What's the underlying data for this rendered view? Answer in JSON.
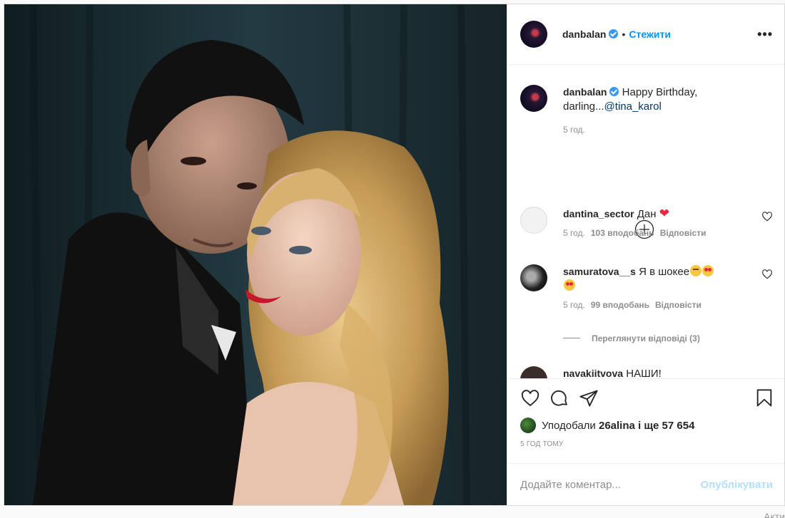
{
  "post": {
    "author": "danbalan",
    "follow_label": "Стежити",
    "dot": "•",
    "more_label": "•••",
    "caption_text": "Happy Birthday, darling...",
    "caption_mention": "@tina_karol",
    "caption_time": "5 год."
  },
  "comments": [
    {
      "user": "dantina_sector",
      "text": "Дан",
      "time": "5 год.",
      "likes": "103 вподобань",
      "reply": "Відповісти"
    },
    {
      "user": "samuratova__s",
      "text": "Я в шокее",
      "time": "5 год.",
      "likes": "99 вподобань",
      "reply": "Відповісти"
    },
    {
      "user": "navakiitvova",
      "text": "НАШИ!"
    }
  ],
  "view_replies": "Переглянути відповіді (3)",
  "likes_prefix": "Уподобали",
  "likes_user": "26alina",
  "likes_suffix": "і ще 57 654",
  "time_ago": "5 ГОД ТОМУ",
  "comment_placeholder": "Додайте коментар...",
  "publish_label": "Опублікувати",
  "corner_text": "Акти",
  "icons": [
    "heart-icon",
    "comment-icon",
    "share-icon",
    "bookmark-icon",
    "add-circle-icon",
    "verified-icon"
  ],
  "colors": {
    "link": "#0095f6",
    "verified": "#3897f0",
    "publish_disabled": "#b2dffc",
    "muted": "#8e8e8e"
  }
}
